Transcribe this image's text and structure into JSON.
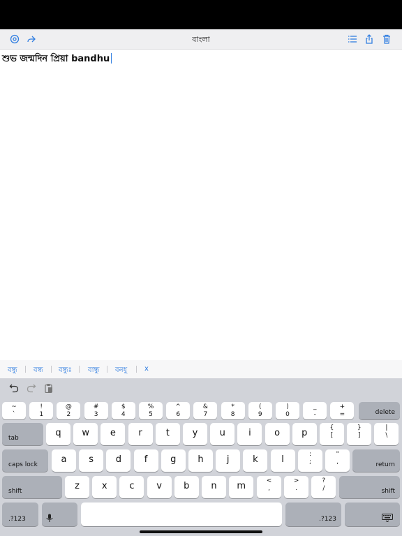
{
  "nav": {
    "title": "বাংলা",
    "icons": [
      "settings-icon",
      "share-forward-icon",
      "list-icon",
      "share-export-icon",
      "trash-icon"
    ]
  },
  "editor": {
    "text": "শুভ জন্মদিন প্রিয়া bandhu"
  },
  "suggestions": [
    "বন্ধু",
    "বন্ধ",
    "বন্ধুঃ",
    "বান্ধু",
    "বনধু",
    "x"
  ],
  "toolbar": {
    "icons": [
      "undo-icon",
      "redo-icon",
      "paste-icon"
    ]
  },
  "keyboard": {
    "number_row": [
      {
        "top": "~",
        "bot": "`"
      },
      {
        "top": "!",
        "bot": "1"
      },
      {
        "top": "@",
        "bot": "2"
      },
      {
        "top": "#",
        "bot": "3"
      },
      {
        "top": "$",
        "bot": "4"
      },
      {
        "top": "%",
        "bot": "5"
      },
      {
        "top": "^",
        "bot": "6"
      },
      {
        "top": "&",
        "bot": "7"
      },
      {
        "top": "*",
        "bot": "8"
      },
      {
        "top": "(",
        "bot": "9"
      },
      {
        "top": ")",
        "bot": "0"
      },
      {
        "top": "_",
        "bot": "-"
      },
      {
        "top": "+",
        "bot": "="
      }
    ],
    "delete_label": "delete",
    "tab_label": "tab",
    "row_q": [
      "q",
      "w",
      "e",
      "r",
      "t",
      "y",
      "u",
      "i",
      "o",
      "p"
    ],
    "row_q_extra": [
      {
        "top": "{",
        "bot": "["
      },
      {
        "top": "}",
        "bot": "]"
      },
      {
        "top": "|",
        "bot": "\\"
      }
    ],
    "caps_label": "caps lock",
    "row_a": [
      "a",
      "s",
      "d",
      "f",
      "g",
      "h",
      "j",
      "k",
      "l"
    ],
    "row_a_extra": [
      {
        "top": ":",
        "bot": ";"
      },
      {
        "top": "\"",
        "bot": ","
      }
    ],
    "return_label": "return",
    "shift_label": "shift",
    "row_z": [
      "z",
      "x",
      "c",
      "v",
      "b",
      "n",
      "m"
    ],
    "row_z_extra": [
      {
        "top": "<",
        "bot": ","
      },
      {
        "top": ">",
        "bot": "."
      },
      {
        "top": "?",
        "bot": "/"
      }
    ],
    "numbers_label": ".?123"
  }
}
